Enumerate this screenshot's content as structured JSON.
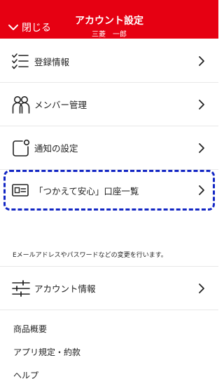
{
  "header": {
    "close_label": "閉じる",
    "title": "アカウント設定",
    "subtitle": "三菱　一郎",
    "background_color": "#e60012"
  },
  "menu": [
    {
      "label": "登録情報",
      "icon": "checklist-icon"
    },
    {
      "label": "メンバー管理",
      "icon": "members-icon"
    },
    {
      "label": "通知の設定",
      "icon": "notification-icon"
    },
    {
      "label": "「つかえて安心」口座一覧",
      "icon": "id-card-icon"
    }
  ],
  "note": "Eメールアドレスやパスワードなどの変更を行います。",
  "account_info": {
    "label": "アカウント情報",
    "icon": "sliders-icon"
  },
  "links": [
    {
      "label": "商品概要"
    },
    {
      "label": "アプリ規定・約款"
    },
    {
      "label": "ヘルプ"
    }
  ],
  "highlight_color": "#1226c4"
}
